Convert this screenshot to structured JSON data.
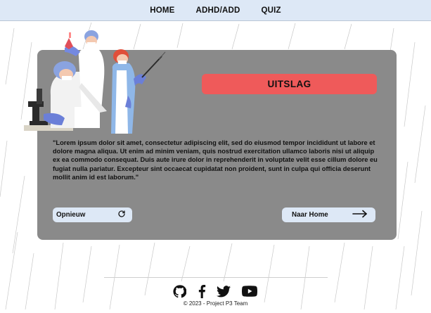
{
  "nav": {
    "items": [
      {
        "label": "HOME"
      },
      {
        "label": "ADHD/ADD"
      },
      {
        "label": "QUIZ"
      }
    ]
  },
  "result": {
    "title": "UITSLAG",
    "description": "\"Lorem ipsum dolor sit amet, consectetur adipiscing elit, sed do eiusmod tempor incididunt ut labore et dolore magna aliqua. Ut enim ad minim veniam, quis nostrud exercitation ullamco laboris nisi ut aliquip ex ea commodo consequat. Duis aute irure dolor in reprehenderit in voluptate velit esse cillum dolore eu fugiat nulla pariatur. Excepteur sint occaecat cupidatat non proident, sunt in culpa qui officia deserunt mollit anim id est laborum.\""
  },
  "buttons": {
    "restart_label": "Opnieuw",
    "restart_icon": "refresh-icon",
    "home_label": "Naar Home",
    "home_icon": "arrow-right-icon"
  },
  "footer": {
    "social_icons": [
      "github-icon",
      "facebook-icon",
      "twitter-icon",
      "youtube-icon"
    ],
    "copyright": "© 2023 - Project P3 Team"
  },
  "colors": {
    "nav_bg": "#dde8f6",
    "card_bg": "#8a8a8a",
    "result_accent": "#ef5a5a",
    "button_bg": "#dde8f6"
  }
}
